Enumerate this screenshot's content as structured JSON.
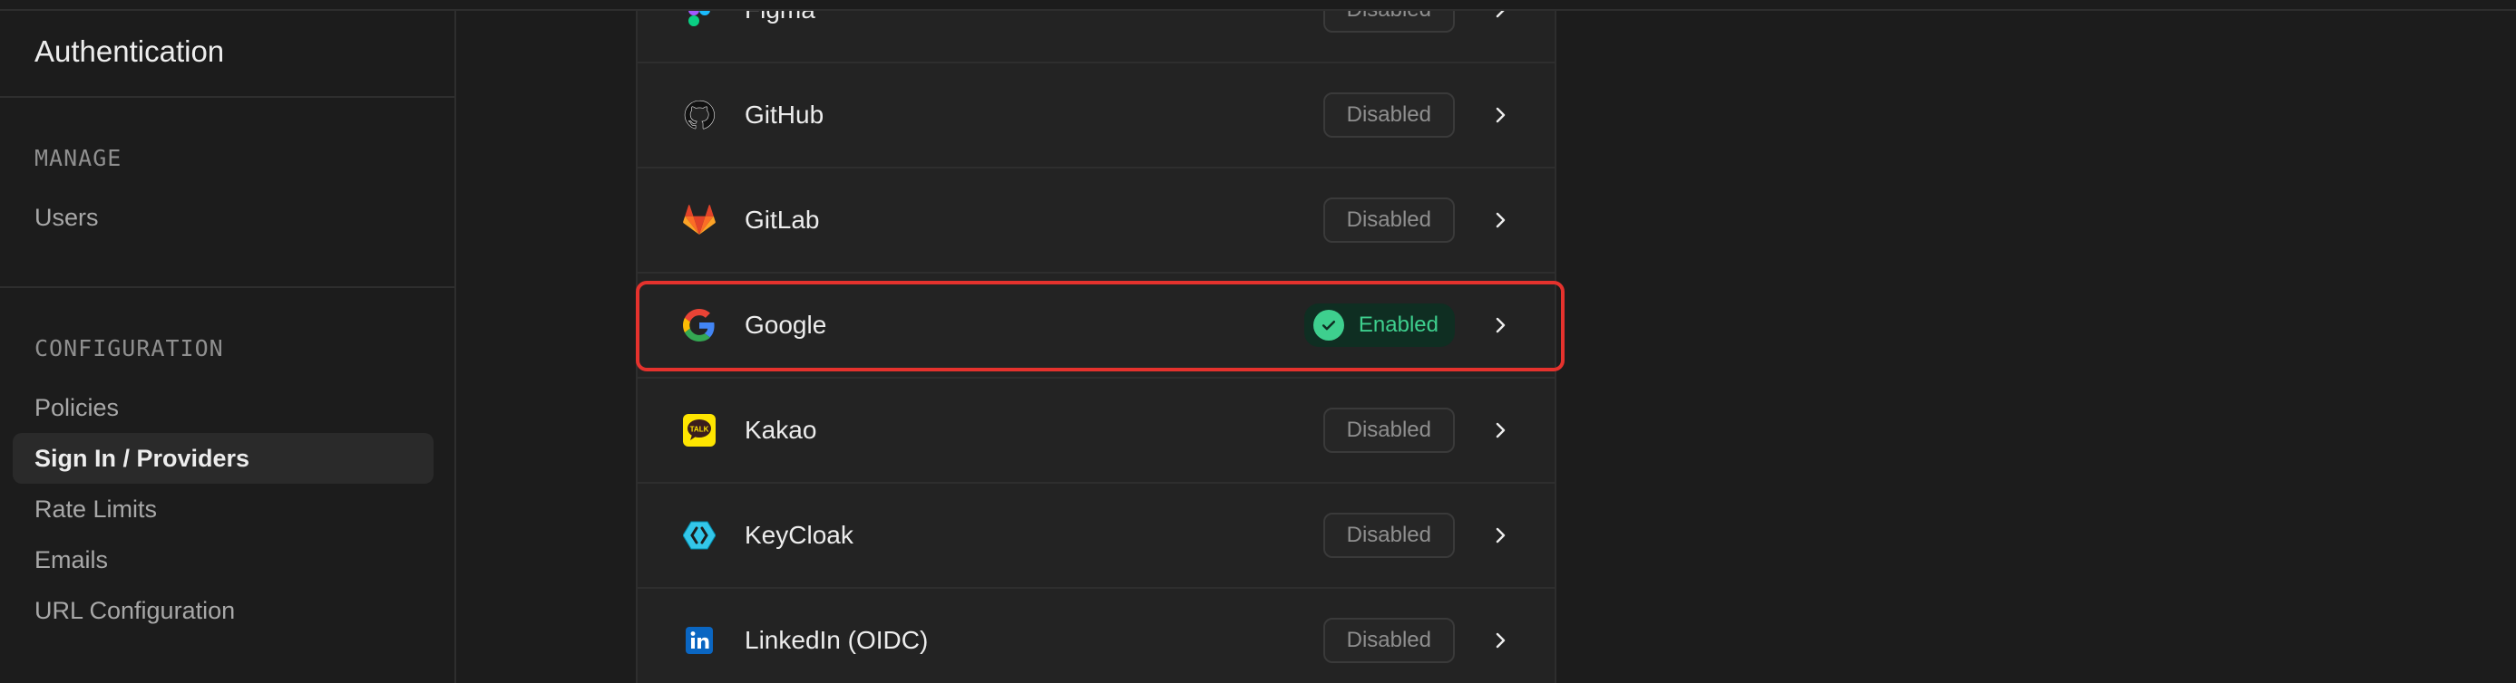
{
  "sidebar": {
    "title": "Authentication",
    "sections": [
      {
        "label": "MANAGE",
        "items": [
          {
            "label": "Users",
            "active": false
          }
        ]
      },
      {
        "label": "CONFIGURATION",
        "items": [
          {
            "label": "Policies",
            "active": false
          },
          {
            "label": "Sign In / Providers",
            "active": true
          },
          {
            "label": "Rate Limits",
            "active": false
          },
          {
            "label": "Emails",
            "active": false
          },
          {
            "label": "URL Configuration",
            "active": false
          }
        ]
      }
    ]
  },
  "providers": [
    {
      "name": "Figma",
      "status": "Disabled",
      "icon": "figma-icon"
    },
    {
      "name": "GitHub",
      "status": "Disabled",
      "icon": "github-icon"
    },
    {
      "name": "GitLab",
      "status": "Disabled",
      "icon": "gitlab-icon"
    },
    {
      "name": "Google",
      "status": "Enabled",
      "icon": "google-icon"
    },
    {
      "name": "Kakao",
      "status": "Disabled",
      "icon": "kakao-icon"
    },
    {
      "name": "KeyCloak",
      "status": "Disabled",
      "icon": "keycloak-icon"
    },
    {
      "name": "LinkedIn (OIDC)",
      "status": "Disabled",
      "icon": "linkedin-icon"
    }
  ],
  "colors": {
    "accent_green": "#3ecf8e",
    "highlight_red": "#e5322d"
  }
}
